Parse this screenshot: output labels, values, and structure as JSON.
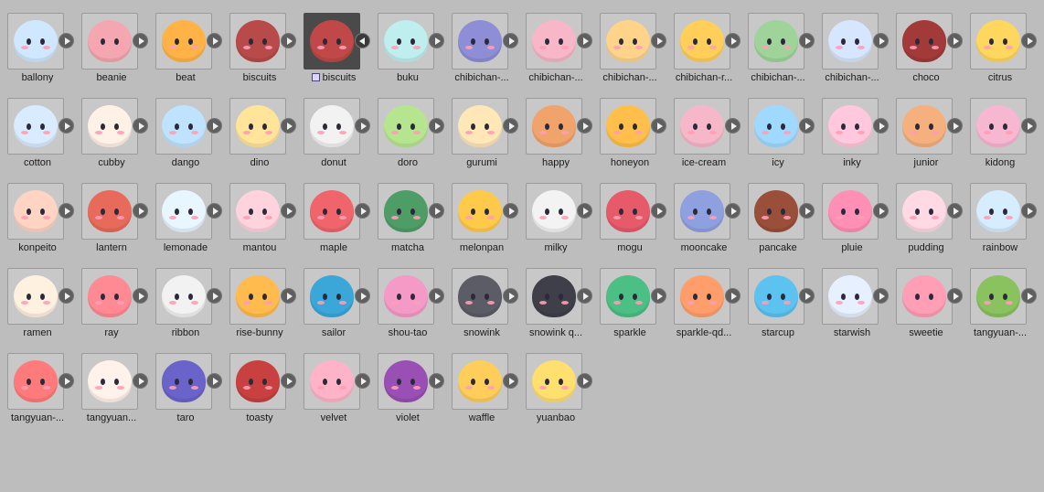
{
  "assets": [
    {
      "label": "ballony",
      "color": "#cfe8ff"
    },
    {
      "label": "beanie",
      "color": "#f4a7b0"
    },
    {
      "label": "beat",
      "color": "#ffb347"
    },
    {
      "label": "biscuits",
      "color": "#b84a4a"
    },
    {
      "label": "biscuits",
      "color": "#c04848",
      "selected": true
    },
    {
      "label": "buku",
      "color": "#bfeeee"
    },
    {
      "label": "chibichan-...",
      "color": "#8e8ed6"
    },
    {
      "label": "chibichan-...",
      "color": "#f7b7c8"
    },
    {
      "label": "chibichan-...",
      "color": "#ffd38a"
    },
    {
      "label": "chibichan-r...",
      "color": "#ffcf5a"
    },
    {
      "label": "chibichan-...",
      "color": "#9ed49a"
    },
    {
      "label": "chibichan-...",
      "color": "#d7e6ff"
    },
    {
      "label": "choco",
      "color": "#a33a3a"
    },
    {
      "label": "citrus",
      "color": "#ffd75e"
    },
    {
      "label": "cotton",
      "color": "#d9ecff"
    },
    {
      "label": "cubby",
      "color": "#fff1e6"
    },
    {
      "label": "dango",
      "color": "#bfe3ff"
    },
    {
      "label": "dino",
      "color": "#ffe49a"
    },
    {
      "label": "donut",
      "color": "#f2f2f2"
    },
    {
      "label": "doro",
      "color": "#b6e58f"
    },
    {
      "label": "gurumi",
      "color": "#ffe7b8"
    },
    {
      "label": "happy",
      "color": "#f0a36b"
    },
    {
      "label": "honeyon",
      "color": "#ffbf4a"
    },
    {
      "label": "ice-cream",
      "color": "#f6b8c9"
    },
    {
      "label": "icy",
      "color": "#9fd9ff"
    },
    {
      "label": "inky",
      "color": "#ffc8dc"
    },
    {
      "label": "junior",
      "color": "#f5b07d"
    },
    {
      "label": "kidong",
      "color": "#f7b7d0"
    },
    {
      "label": "konpeito",
      "color": "#ffd4c2"
    },
    {
      "label": "lantern",
      "color": "#e86a5a"
    },
    {
      "label": "lemonade",
      "color": "#e8f6ff"
    },
    {
      "label": "mantou",
      "color": "#ffd3de"
    },
    {
      "label": "maple",
      "color": "#f0646c"
    },
    {
      "label": "matcha",
      "color": "#4f9d66"
    },
    {
      "label": "melonpan",
      "color": "#ffc94a"
    },
    {
      "label": "milky",
      "color": "#f3f3f3"
    },
    {
      "label": "mogu",
      "color": "#e65a6a"
    },
    {
      "label": "mooncake",
      "color": "#8fa0e0"
    },
    {
      "label": "pancake",
      "color": "#9a4f3a"
    },
    {
      "label": "pluie",
      "color": "#ff8fb5"
    },
    {
      "label": "pudding",
      "color": "#ffd9e3"
    },
    {
      "label": "rainbow",
      "color": "#d6ecff"
    },
    {
      "label": "ramen",
      "color": "#fff1e0"
    },
    {
      "label": "ray",
      "color": "#ff8a94"
    },
    {
      "label": "ribbon",
      "color": "#f2f2f2"
    },
    {
      "label": "rise-bunny",
      "color": "#ffbb4d"
    },
    {
      "label": "sailor",
      "color": "#3aa7d8"
    },
    {
      "label": "shou-tao",
      "color": "#f59ac6"
    },
    {
      "label": "snowink",
      "color": "#5c5c66"
    },
    {
      "label": "snowink q...",
      "color": "#3f3f4a"
    },
    {
      "label": "sparkle",
      "color": "#4bbf84"
    },
    {
      "label": "sparkle-qd...",
      "color": "#ff9e6b"
    },
    {
      "label": "starcup",
      "color": "#5cc3f0"
    },
    {
      "label": "starwish",
      "color": "#e6f0ff"
    },
    {
      "label": "sweetie",
      "color": "#ff9eb4"
    },
    {
      "label": "tangyuan-...",
      "color": "#8ac25f"
    },
    {
      "label": "tangyuan-...",
      "color": "#ff7a7a"
    },
    {
      "label": "tangyuan...",
      "color": "#fff2ea"
    },
    {
      "label": "taro",
      "color": "#6a63c9"
    },
    {
      "label": "toasty",
      "color": "#c84040"
    },
    {
      "label": "velvet",
      "color": "#ffb3c8"
    },
    {
      "label": "violet",
      "color": "#9a4fb5"
    },
    {
      "label": "waffle",
      "color": "#ffcd5a"
    },
    {
      "label": "yuanbao",
      "color": "#ffdf6e"
    }
  ]
}
